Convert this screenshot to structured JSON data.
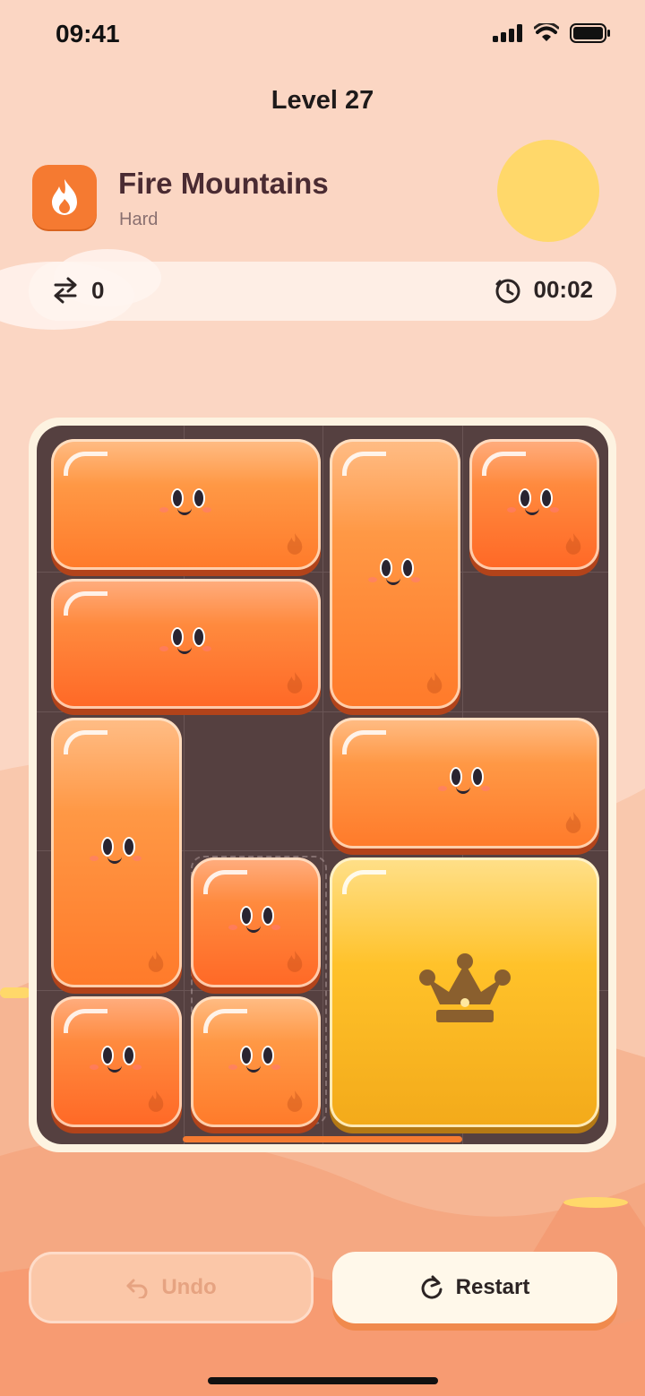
{
  "status_bar": {
    "time": "09:41"
  },
  "header": {
    "level_title": "Level 27"
  },
  "world": {
    "name": "Fire Mountains",
    "difficulty": "Hard",
    "icon": "flame-icon",
    "accent": "#f57a31"
  },
  "stats": {
    "moves": "0",
    "timer": "00:02",
    "moves_icon": "swap-arrows-icon",
    "timer_icon": "stopwatch-icon"
  },
  "board": {
    "columns": 4,
    "rows": 5,
    "blocks": [
      {
        "id": "b1",
        "kind": "face",
        "color": "orange",
        "col": 0,
        "row": 0,
        "w": 2,
        "h": 1
      },
      {
        "id": "b2",
        "kind": "face",
        "color": "orange",
        "col": 2,
        "row": 0,
        "w": 1,
        "h": 2
      },
      {
        "id": "b3",
        "kind": "face",
        "color": "red",
        "col": 3,
        "row": 0,
        "w": 1,
        "h": 1
      },
      {
        "id": "b4",
        "kind": "face",
        "color": "red",
        "col": 0,
        "row": 1,
        "w": 2,
        "h": 1
      },
      {
        "id": "b5",
        "kind": "face",
        "color": "orange",
        "col": 0,
        "row": 2,
        "w": 1,
        "h": 2
      },
      {
        "id": "b6",
        "kind": "face",
        "color": "orange",
        "col": 2,
        "row": 2,
        "w": 2,
        "h": 1
      },
      {
        "id": "b7",
        "kind": "face",
        "color": "red",
        "col": 1,
        "row": 3,
        "w": 1,
        "h": 1
      },
      {
        "id": "b8",
        "kind": "crown",
        "color": "gold",
        "col": 2,
        "row": 3,
        "w": 2,
        "h": 2
      },
      {
        "id": "b9",
        "kind": "face",
        "color": "red",
        "col": 0,
        "row": 4,
        "w": 1,
        "h": 1
      },
      {
        "id": "b10",
        "kind": "face",
        "color": "orange",
        "col": 1,
        "row": 4,
        "w": 1,
        "h": 1
      }
    ]
  },
  "controls": {
    "undo_label": "Undo",
    "restart_label": "Restart",
    "undo_icon": "undo-arrow-icon",
    "restart_icon": "restart-icon"
  },
  "colors": {
    "background": "#fbd6c3",
    "board": "#554040",
    "block_orange": "#ff8a36",
    "block_gold": "#ffc22a",
    "sun": "#ffd86a"
  }
}
